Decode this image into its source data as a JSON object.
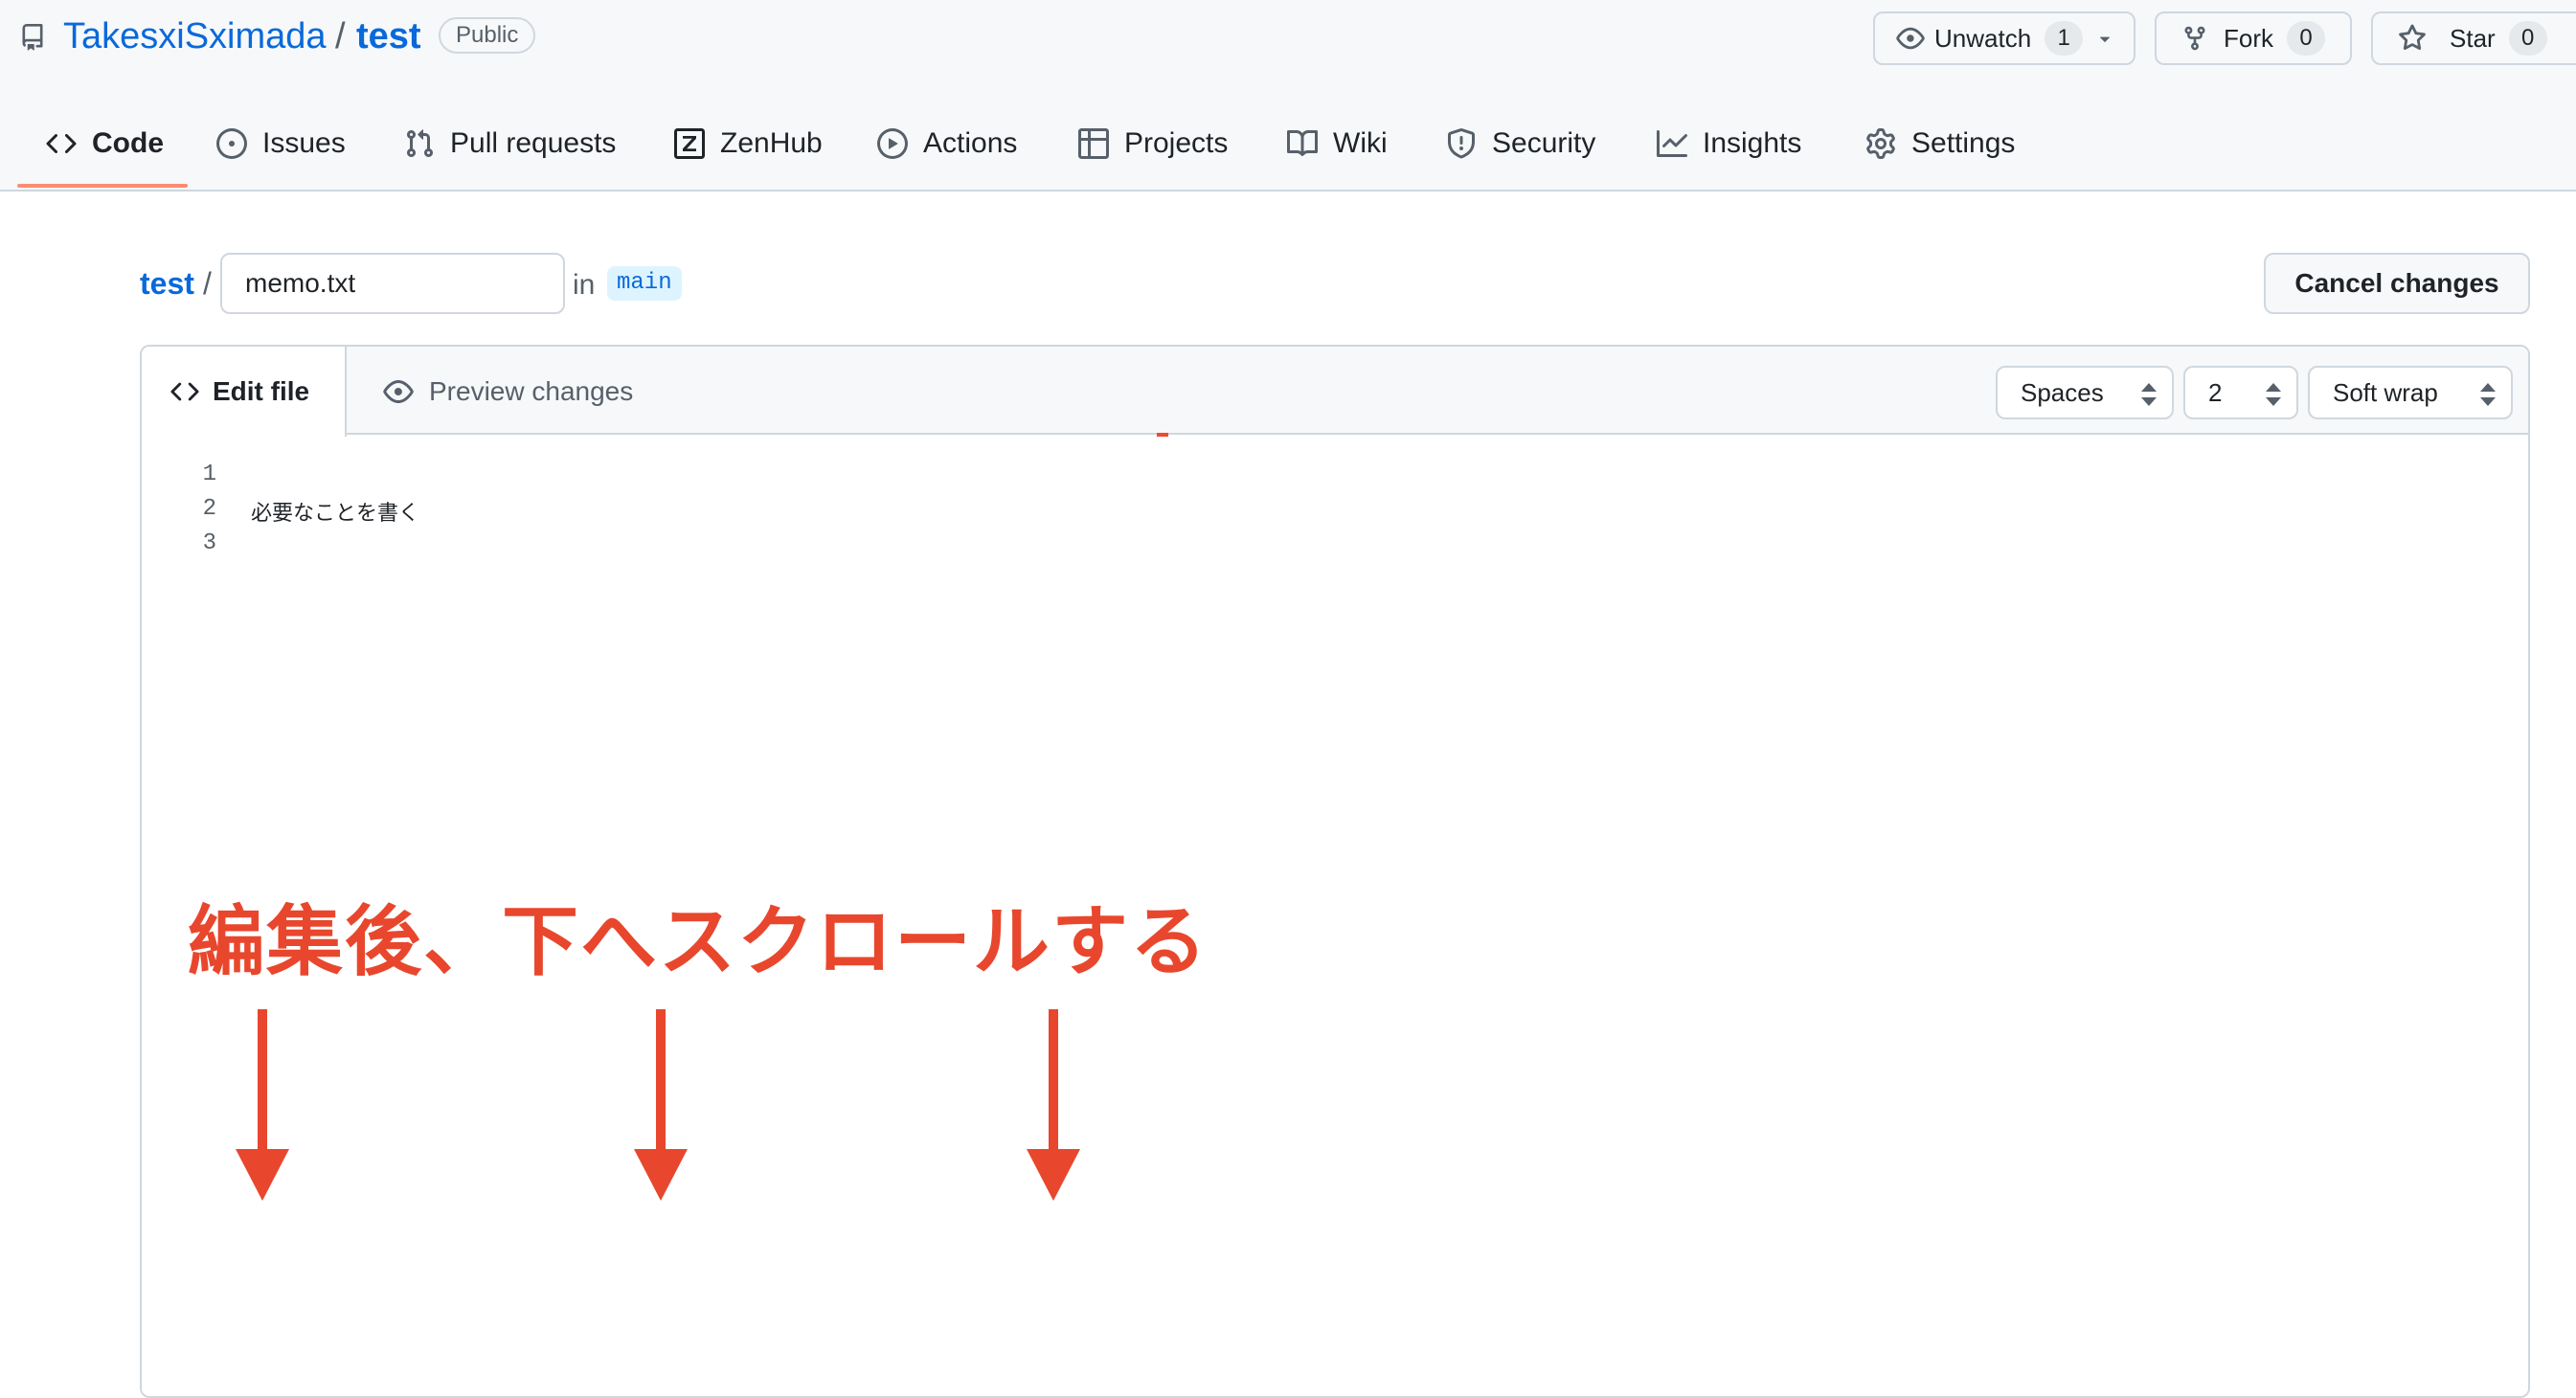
{
  "header": {
    "owner": "TakesxiSximada",
    "separator": "/",
    "repo": "test",
    "visibility": "Public",
    "watch": {
      "label": "Unwatch",
      "count": "1"
    },
    "fork": {
      "label": "Fork",
      "count": "0"
    },
    "star": {
      "label": "Star",
      "count": "0"
    }
  },
  "tabs": [
    {
      "label": "Code",
      "icon": "code-icon",
      "active": true
    },
    {
      "label": "Issues",
      "icon": "issue-icon"
    },
    {
      "label": "Pull requests",
      "icon": "pull-request-icon"
    },
    {
      "label": "ZenHub",
      "icon": "zenhub-icon"
    },
    {
      "label": "Actions",
      "icon": "play-icon"
    },
    {
      "label": "Projects",
      "icon": "table-icon"
    },
    {
      "label": "Wiki",
      "icon": "book-icon"
    },
    {
      "label": "Security",
      "icon": "shield-icon"
    },
    {
      "label": "Insights",
      "icon": "graph-icon"
    },
    {
      "label": "Settings",
      "icon": "gear-icon"
    }
  ],
  "breadcrumb": {
    "repo": "test",
    "separator": "/",
    "filename": "memo.txt",
    "in_label": "in",
    "branch": "main"
  },
  "cancel_label": "Cancel changes",
  "editor": {
    "edit_tab": "Edit file",
    "preview_tab": "Preview changes",
    "indent_mode": "Spaces",
    "indent_size": "2",
    "wrap_mode": "Soft wrap",
    "lines": [
      {
        "number": "1",
        "text": ""
      },
      {
        "number": "2",
        "text": "必要なことを書く"
      },
      {
        "number": "3",
        "text": ""
      }
    ]
  },
  "annotation": {
    "text": "編集後、下へスクロールする",
    "color": "#e8472d"
  },
  "colors": {
    "link": "#0969da",
    "tab_underline": "#fd8c73",
    "border": "#d0d7de"
  }
}
